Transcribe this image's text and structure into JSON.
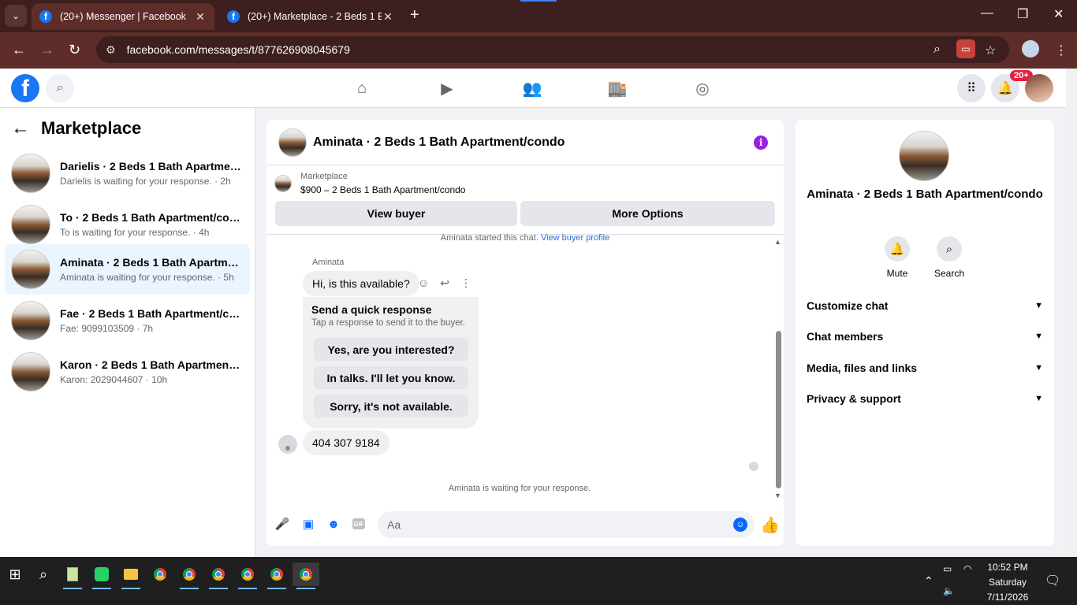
{
  "browser": {
    "tabs": [
      {
        "title": "(20+) Messenger | Facebook",
        "active": true
      },
      {
        "title": "(20+) Marketplace - 2 Beds 1 Ba",
        "active": false
      }
    ],
    "url": "facebook.com/messages/t/877626908045679"
  },
  "fb_header": {
    "notification_badge": "20+"
  },
  "left_panel": {
    "title": "Marketplace",
    "conversations": [
      {
        "name": "Darielis · 2 Beds 1 Bath Apartment...",
        "sub": "Darielis is waiting for your response. · 2h",
        "selected": false
      },
      {
        "name": "To · 2 Beds 1 Bath Apartment/condo",
        "sub": "To is waiting for your response. · 4h",
        "selected": false
      },
      {
        "name": "Aminata · 2 Beds 1 Bath Apartmen...",
        "sub": "Aminata is waiting for your response. · 5h",
        "selected": true
      },
      {
        "name": "Fae · 2 Beds 1 Bath Apartment/con...",
        "sub": "Fae: 9099103509 · 7h",
        "selected": false
      },
      {
        "name": "Karon · 2 Beds 1 Bath Apartment/c...",
        "sub": "Karon: 2029044607 · 10h",
        "selected": false
      }
    ]
  },
  "chat": {
    "title": "Aminata · 2 Beds 1 Bath Apartment/condo",
    "marketplace_label": "Marketplace",
    "listing": "$900 – 2 Beds 1 Bath Apartment/condo",
    "view_buyer": "View buyer",
    "more_options": "More Options",
    "started_text": "Aminata started this chat.",
    "view_buyer_profile": "View buyer profile",
    "sender_name": "Aminata",
    "message1": "Hi, is this available?",
    "quick_response": {
      "heading": "Send a quick response",
      "subtext": "Tap a response to send it to the buyer.",
      "options": [
        "Yes, are you interested?",
        "In talks. I'll let you know.",
        "Sorry, it's not available."
      ]
    },
    "message2": "404 307 9184",
    "waiting": "Aminata is waiting for your response.",
    "composer_placeholder": "Aa"
  },
  "right_panel": {
    "name": "Aminata · 2 Beds 1 Bath Apartment/condo",
    "mute": "Mute",
    "search": "Search",
    "sections": [
      "Customize chat",
      "Chat members",
      "Media, files and links",
      "Privacy & support"
    ]
  },
  "taskbar": {
    "time": "10:52 PM",
    "day": "Saturday",
    "date": "7/11/2026"
  }
}
